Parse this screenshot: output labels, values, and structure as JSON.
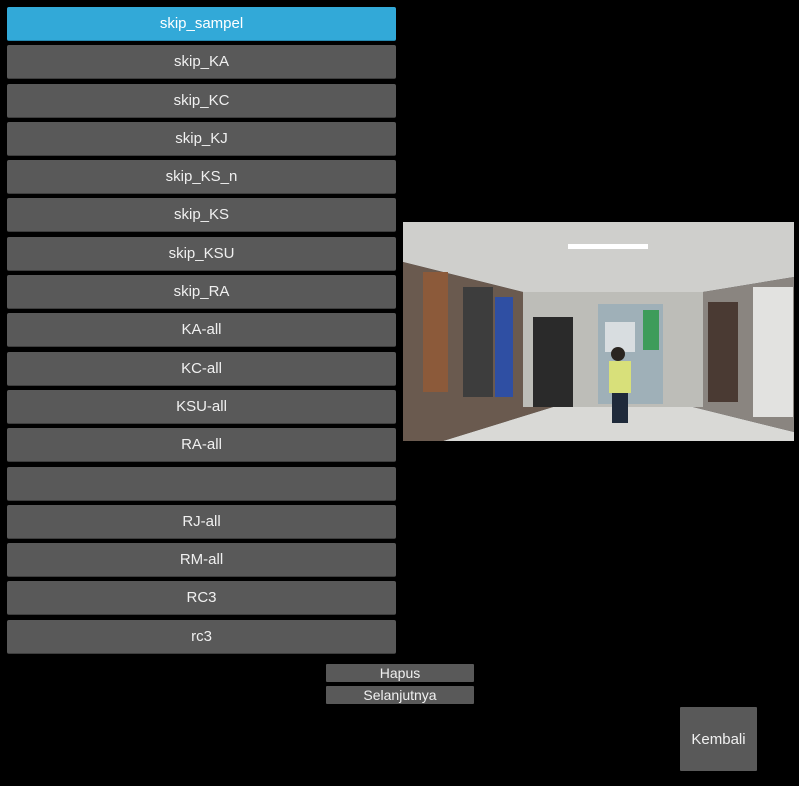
{
  "list": {
    "items": [
      {
        "label": "skip_sampel",
        "selected": true
      },
      {
        "label": "skip_KA",
        "selected": false
      },
      {
        "label": "skip_KC",
        "selected": false
      },
      {
        "label": "skip_KJ",
        "selected": false
      },
      {
        "label": "skip_KS_n",
        "selected": false
      },
      {
        "label": "skip_KS",
        "selected": false
      },
      {
        "label": "skip_KSU",
        "selected": false
      },
      {
        "label": "skip_RA",
        "selected": false
      },
      {
        "label": "KA-all",
        "selected": false
      },
      {
        "label": "KC-all",
        "selected": false
      },
      {
        "label": "KSU-all",
        "selected": false
      },
      {
        "label": "RA-all",
        "selected": false
      },
      {
        "label": "",
        "selected": false
      },
      {
        "label": "RJ-all",
        "selected": false
      },
      {
        "label": "RM-all",
        "selected": false
      },
      {
        "label": "RC3",
        "selected": false
      },
      {
        "label": "rc3",
        "selected": false
      }
    ]
  },
  "buttons": {
    "delete_label": "Hapus",
    "next_label": "Selanjutnya",
    "back_label": "Kembali"
  },
  "colors": {
    "selected": "#32a9d8",
    "button": "#595959",
    "background": "#000000"
  }
}
